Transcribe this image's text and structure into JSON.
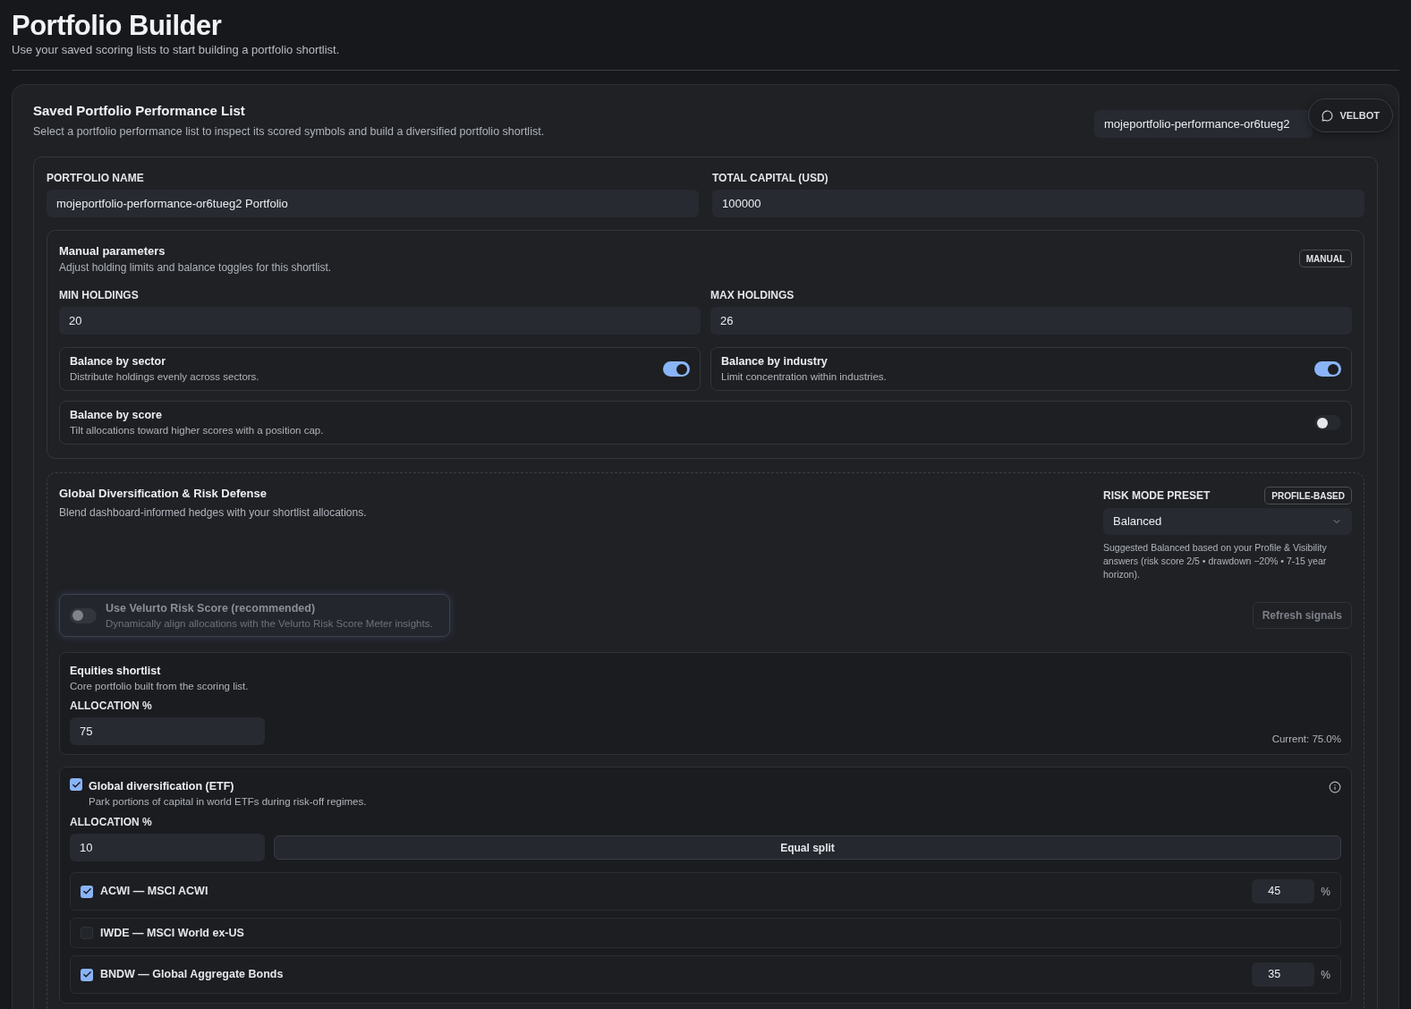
{
  "header": {
    "title": "Portfolio Builder",
    "subtitle": "Use your saved scoring lists to start building a portfolio shortlist."
  },
  "velbot_button": {
    "label": "VELBOT"
  },
  "saved_list": {
    "title": "Saved Portfolio Performance List",
    "description": "Select a portfolio performance list to inspect its scored symbols and build a diversified portfolio shortlist.",
    "list_select": {
      "value": "mojeportfolio-performance-or6tueg2"
    }
  },
  "portfolio_fields": [
    {
      "label": "PORTFOLIO NAME",
      "value": "mojeportfolio-performance-or6tueg2 Portfolio"
    },
    {
      "label": "TOTAL CAPITAL (USD)",
      "value": "100000"
    }
  ],
  "manual_parameters": {
    "title": "Manual parameters",
    "description": "Adjust holding limits and balance toggles for this shortlist.",
    "badge": "MANUAL",
    "fields": [
      {
        "label": "MIN HOLDINGS",
        "value": "20"
      },
      {
        "label": "MAX HOLDINGS",
        "value": "26"
      }
    ],
    "toggles": [
      {
        "title": "Balance by sector",
        "description": "Distribute holdings evenly across sectors.",
        "on": true
      },
      {
        "title": "Balance by industry",
        "description": "Limit concentration within industries.",
        "on": true
      },
      {
        "title": "Balance by score",
        "description": "Tilt allocations toward higher scores with a position cap.",
        "on": false
      }
    ]
  },
  "risk_defense": {
    "title": "Global Diversification & Risk Defense",
    "description": "Blend dashboard-informed hedges with your shortlist allocations.",
    "preset": {
      "label": "RISK MODE PRESET",
      "badge": "PROFILE-BASED",
      "value": "Balanced",
      "hint": "Suggested Balanced based on your Profile & Visibility answers (risk score 2/5 • drawdown −20% • 7-15 year horizon)."
    },
    "risk_score_toggle": {
      "title": "Use Velurto Risk Score (recommended)",
      "description": "Dynamically align allocations with the Velurto Risk Score Meter insights.",
      "on": false,
      "disabled": true
    },
    "refresh_button": {
      "label": "Refresh signals",
      "disabled": true
    },
    "equities_shortlist": {
      "title": "Equities shortlist",
      "description": "Core portfolio built from the scoring list.",
      "allocation_label": "ALLOCATION %",
      "allocation": "75",
      "current": "Current: 75.0%"
    },
    "global_diversification": {
      "checked": true,
      "title": "Global diversification (ETF)",
      "description": "Park portions of capital in world ETFs during risk-off regimes.",
      "allocation_label": "ALLOCATION %",
      "allocation": "10",
      "equal_split_button": "Equal split",
      "etfs": [
        {
          "label": "ACWI — MSCI ACWI",
          "checked": true,
          "weight": "45",
          "unit": "%"
        },
        {
          "label": "IWDE — MSCI World ex-US",
          "checked": false
        },
        {
          "label": "BNDW — Global Aggregate Bonds",
          "checked": true,
          "weight": "35",
          "unit": "%"
        }
      ]
    }
  }
}
